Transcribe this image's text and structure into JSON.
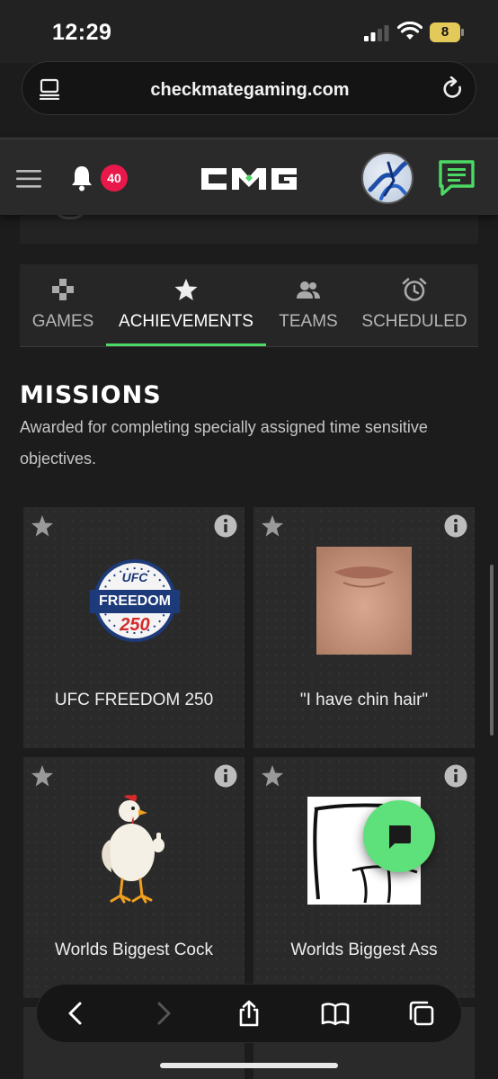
{
  "status_bar": {
    "time": "12:29",
    "battery": "8"
  },
  "browser": {
    "url": "checkmategaming.com"
  },
  "header": {
    "notification_count": "40",
    "logo_text": "CMG"
  },
  "tabs": [
    {
      "label": "GAMES",
      "icon": "gamepad-icon"
    },
    {
      "label": "ACHIEVEMENTS",
      "icon": "star-icon",
      "active": true
    },
    {
      "label": "TEAMS",
      "icon": "people-icon"
    },
    {
      "label": "SCHEDULED",
      "icon": "alarm-icon"
    }
  ],
  "missions": {
    "title": "MISSIONS",
    "description": "Awarded for completing specially assigned time sensitive objectives.",
    "items": [
      {
        "name": "UFC FREEDOM 250",
        "badge_top": "UFC",
        "badge_mid": "FREEDOM",
        "badge_num": "250"
      },
      {
        "name": "\"I have chin hair\""
      },
      {
        "name": "Worlds Biggest Cock"
      },
      {
        "name": "Worlds Biggest Ass"
      }
    ]
  },
  "colors": {
    "accent": "#4cd964",
    "badge": "#e8194a",
    "background": "#1c1c1c"
  }
}
